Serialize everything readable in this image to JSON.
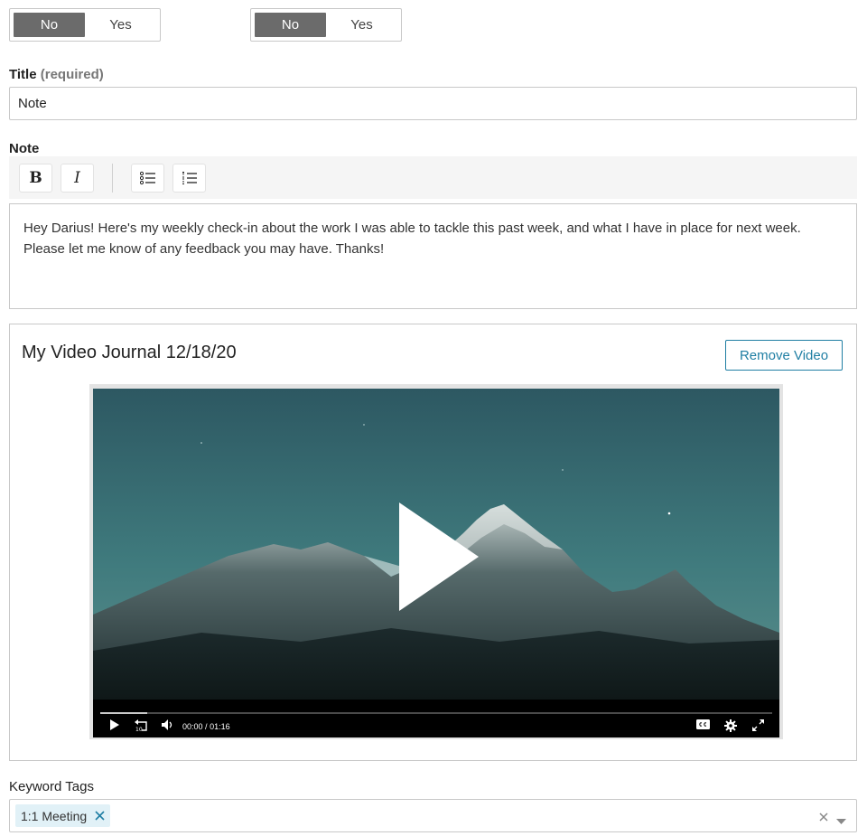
{
  "toggles": [
    {
      "no_label": "No",
      "yes_label": "Yes",
      "selected": "No"
    },
    {
      "no_label": "No",
      "yes_label": "Yes",
      "selected": "No"
    }
  ],
  "title_field": {
    "label": "Title",
    "label_hint": "(required)",
    "value": "Note"
  },
  "note_field": {
    "label": "Note",
    "toolbar": {
      "bold": "B",
      "italic": "I"
    },
    "value": "Hey Darius! Here's my weekly check-in about the work I was able to tackle this past week, and what I have in place for next week. Please let me know of any feedback you may have. Thanks!"
  },
  "video": {
    "title": "My Video Journal 12/18/20",
    "remove_label": "Remove Video",
    "current_time": "00:00",
    "separator": "/",
    "duration": "01:16",
    "progress_fraction": 0.07,
    "icons": [
      "play-icon",
      "rewind-10-icon",
      "volume-icon",
      "closed-captions-icon",
      "settings-gear-icon",
      "fullscreen-icon"
    ]
  },
  "keyword_tags": {
    "label": "Keyword Tags",
    "tags": [
      {
        "label": "1:1 Meeting"
      }
    ]
  },
  "colors": {
    "toggle_active": "#6b6b6b",
    "accent": "#1f7ea3",
    "tag_bg": "#e1f1f7",
    "toolbar_bg": "#f5f5f5",
    "border": "#c8c8c8"
  }
}
